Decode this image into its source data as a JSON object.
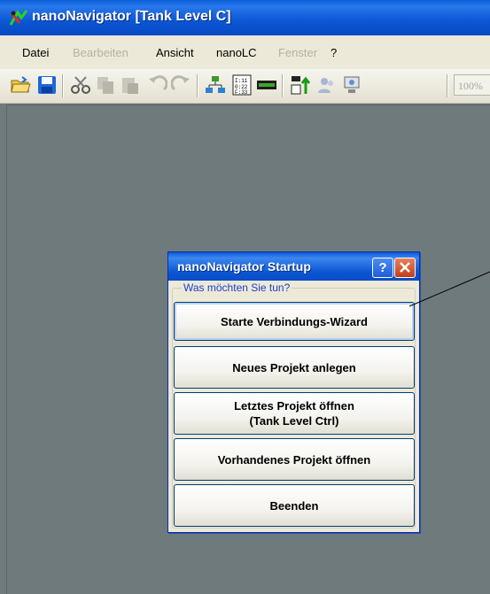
{
  "window": {
    "title": "nanoNavigator [Tank Level C]"
  },
  "menu": {
    "items": [
      {
        "label": "Datei",
        "enabled": true
      },
      {
        "label": "Bearbeiten",
        "enabled": false
      },
      {
        "label": "Ansicht",
        "enabled": true
      },
      {
        "label": "nanoLC",
        "enabled": true
      },
      {
        "label": "Fenster",
        "enabled": false
      },
      {
        "label": "?",
        "enabled": true
      }
    ]
  },
  "toolbar": {
    "zoom": "100%",
    "icons": [
      "open-folder-icon",
      "save-icon",
      "cut-icon",
      "copy-icon",
      "paste-icon",
      "undo-icon",
      "redo-icon",
      "network-icon",
      "io-table-icon",
      "bar-icon",
      "transfer-icon",
      "users-icon",
      "monitor-icon"
    ]
  },
  "dialog": {
    "title": "nanoNavigator Startup",
    "help_label": "?",
    "group_label": "Was möchten Sie tun?",
    "buttons": {
      "wizard": "Starte Verbindungs-Wizard",
      "new_project": "Neues Projekt anlegen",
      "last_project_line1": "Letztes Projekt öffnen",
      "last_project_line2": "(Tank Level Ctrl)",
      "open_existing": "Vorhandenes Projekt öffnen",
      "exit": "Beenden"
    }
  },
  "colors": {
    "titlebar": "#0a56d2",
    "workspace": "#6f7a7c",
    "menubar": "#ece9d8"
  }
}
